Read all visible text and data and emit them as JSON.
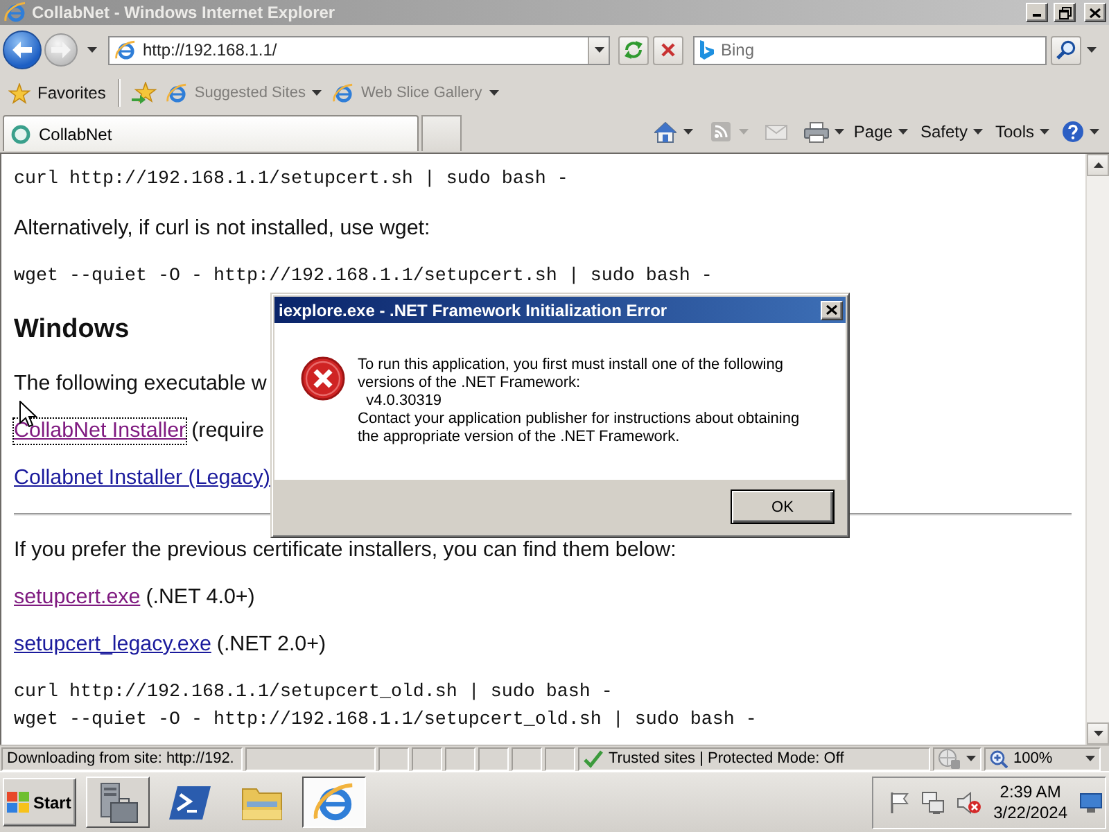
{
  "window": {
    "title": "CollabNet - Windows Internet Explorer",
    "active": false
  },
  "navigation": {
    "back_enabled": true,
    "forward_enabled": false,
    "url": "http://192.168.1.1/",
    "search_placeholder": "Bing"
  },
  "favorites_bar": {
    "label": "Favorites",
    "links": [
      {
        "label": "Suggested Sites",
        "disabled": true
      },
      {
        "label": "Web Slice Gallery",
        "disabled": true
      }
    ]
  },
  "tabs": [
    {
      "label": "CollabNet",
      "selected": true
    }
  ],
  "command_bar": {
    "tools": [
      {
        "kind": "home",
        "disabled": false,
        "menu": true
      },
      {
        "kind": "feeds",
        "disabled": true,
        "menu": true
      },
      {
        "kind": "mail",
        "disabled": true,
        "menu": false
      },
      {
        "kind": "print",
        "disabled": false,
        "menu": true
      }
    ],
    "menus": [
      {
        "label": "Page"
      },
      {
        "label": "Safety"
      },
      {
        "label": "Tools"
      }
    ]
  },
  "page": {
    "blocks": [
      {
        "kind": "code",
        "lines": [
          "curl http://192.168.1.1/setupcert.sh | sudo bash -"
        ]
      },
      {
        "kind": "paragraph",
        "text": "Alternatively, if curl is not installed, use wget:"
      },
      {
        "kind": "code",
        "lines": [
          "wget --quiet -O - http://192.168.1.1/setupcert.sh | sudo bash -"
        ]
      },
      {
        "kind": "heading",
        "text": "Windows"
      },
      {
        "kind": "paragraph",
        "text": "The following executable w"
      },
      {
        "kind": "link",
        "link": "CollabNet Installer",
        "visited": true,
        "focused": true,
        "note": "(require"
      },
      {
        "kind": "link",
        "link": "Collabnet Installer (Legacy)",
        "visited": false,
        "focused": false
      },
      {
        "kind": "rule"
      },
      {
        "kind": "paragraph",
        "text": "If you prefer the previous certificate installers, you can find them below:"
      },
      {
        "kind": "link",
        "link": "setupcert.exe",
        "visited": true,
        "focused": false,
        "note": "(.NET 4.0+)"
      },
      {
        "kind": "link",
        "link": "setupcert_legacy.exe",
        "visited": false,
        "focused": false,
        "note": "(.NET 2.0+)"
      },
      {
        "kind": "code",
        "lines": [
          "curl http://192.168.1.1/setupcert_old.sh | sudo bash -",
          "wget --quiet -O - http://192.168.1.1/setupcert_old.sh | sudo bash -"
        ]
      }
    ]
  },
  "dialog": {
    "title": "iexplore.exe - .NET Framework Initialization Error",
    "active": true,
    "message": "To run this application, you first must install one of the following\nversions of the .NET Framework:\n  v4.0.30319\nContact your application publisher for instructions about obtaining\nthe appropriate version of the .NET Framework.",
    "buttons": [
      {
        "label": "OK",
        "default": true
      }
    ]
  },
  "status_bar": {
    "message": "Downloading from site: http://192.",
    "zone": "Trusted sites | Protected Mode: Off",
    "zoom": "100%"
  },
  "taskbar": {
    "start": "Start",
    "apps": [
      {
        "kind": "server_manager",
        "running": true,
        "selected": false
      },
      {
        "kind": "powershell",
        "running": false,
        "selected": false
      },
      {
        "kind": "explorer",
        "running": false,
        "selected": false
      },
      {
        "kind": "internet_explorer",
        "running": true,
        "selected": true
      }
    ],
    "tray": {
      "volume_muted": true
    },
    "clock": {
      "time": "2:39 AM",
      "date": "3/22/2024"
    }
  }
}
